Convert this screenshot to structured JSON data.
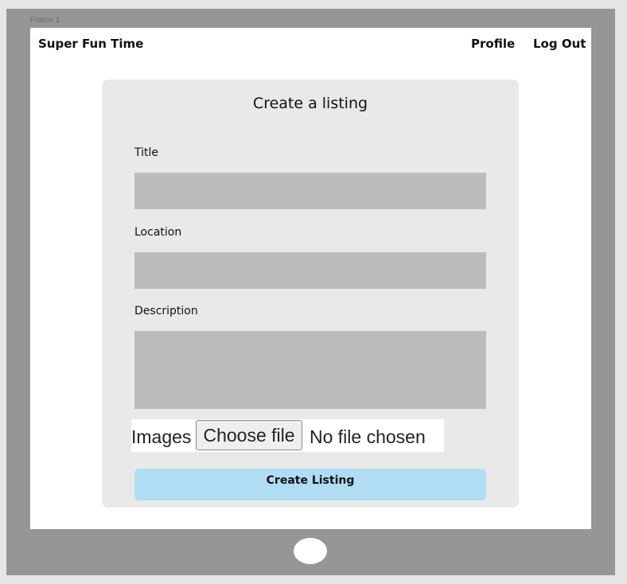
{
  "frame": {
    "label": "Frame 1"
  },
  "navbar": {
    "brand": "Super Fun Time",
    "links": [
      {
        "label": "Profile"
      },
      {
        "label": "Log Out"
      }
    ]
  },
  "form": {
    "title": "Create a listing",
    "fields": {
      "title": {
        "label": "Title",
        "value": ""
      },
      "location": {
        "label": "Location",
        "value": ""
      },
      "description": {
        "label": "Description",
        "value": ""
      }
    },
    "images": {
      "label": "Images",
      "button_label": "Choose file",
      "status": "No file chosen"
    },
    "submit_label": "Create Listing"
  },
  "colors": {
    "device_bezel": "#969696",
    "screen_bg": "#ffffff",
    "card_bg": "#e9e9e9",
    "input_bg": "#bcbcbc",
    "submit_bg": "#b0ddf3"
  },
  "icons": {
    "home_button": "home-button-circle"
  }
}
